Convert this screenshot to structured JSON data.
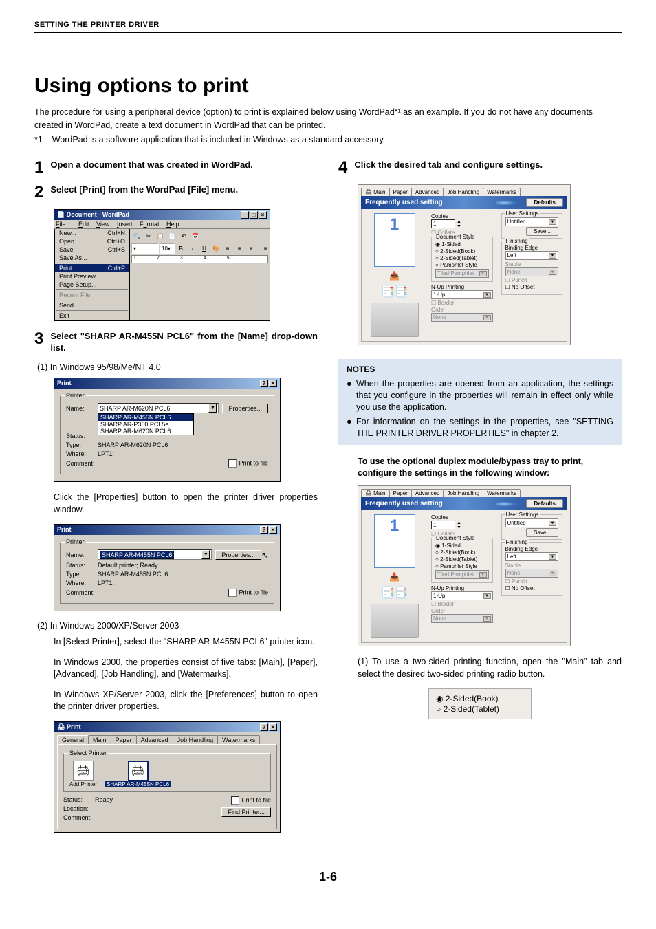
{
  "header": "SETTING THE PRINTER DRIVER",
  "title": "Using options to print",
  "intro": "The procedure for using a peripheral device (option) to print is explained below using WordPad*¹ as an example. If you do not have any documents created in WordPad, create a text document in WordPad that can be printed.",
  "footnote_label": "*1",
  "footnote_text": "WordPad is a software application that is included in Windows as a standard accessory.",
  "step1": {
    "num": "1",
    "text": "Open a document that was created in WordPad."
  },
  "step2": {
    "num": "2",
    "text": "Select [Print] from the WordPad [File] menu."
  },
  "step3": {
    "num": "3",
    "text": "Select \"SHARP AR-M455N PCL6\" from the [Name] drop-down list."
  },
  "step3_sub1": "(1)  In Windows 95/98/Me/NT 4.0",
  "step3_body1": "Click the [Properties] button to open the printer driver properties window.",
  "step3_sub2": "(2)  In Windows 2000/XP/Server 2003",
  "step3_body2a": "In [Select Printer], select the \"SHARP AR-M455N PCL6\" printer icon.",
  "step3_body2b": "In Windows 2000, the properties consist of five tabs: [Main], [Paper], [Advanced], [Job Handling], and [Watermarks].",
  "step3_body2c": "In Windows XP/Server 2003, click the [Preferences] button to open the printer driver properties.",
  "step4": {
    "num": "4",
    "text": "Click the desired tab and configure settings."
  },
  "notes_title": "NOTES",
  "notes": [
    "When the properties are opened from an application, the settings that you configure in the properties will remain in effect only while you use the application.",
    "For information on the settings in the properties, see \"SETTING THE PRINTER DRIVER PROPERTIES\" in chapter 2."
  ],
  "bold_para": "To use the optional duplex module/bypass tray to print, configure the settings in the following window:",
  "duplex_text": "(1) To use a two-sided printing function, open the \"Main\" tab and select the desired two-sided printing radio button.",
  "radio_opts": {
    "book": "2-Sided(Book)",
    "tablet": "2-Sided(Tablet)"
  },
  "page_num": "1-6",
  "wordpad": {
    "title": "Document - WordPad",
    "menus": {
      "file": "File",
      "edit": "Edit",
      "view": "View",
      "insert": "Insert",
      "format": "Format",
      "help": "Help"
    },
    "items": {
      "new": "New...",
      "new_sc": "Ctrl+N",
      "open": "Open...",
      "open_sc": "Ctrl+O",
      "save": "Save",
      "save_sc": "Ctrl+S",
      "saveas": "Save As...",
      "print": "Print...",
      "print_sc": "Ctrl+P",
      "preview": "Print Preview",
      "pagesetup": "Page Setup...",
      "recent": "Recent File",
      "send": "Send...",
      "exit": "Exit"
    },
    "fontsize": "10",
    "ruler": [
      "1",
      "2",
      "3",
      "4",
      "5"
    ]
  },
  "print95": {
    "title": "Print",
    "legend": "Printer",
    "name_lbl": "Name:",
    "name_val": "SHARP AR-M620N PCL6",
    "props_btn": "Properties...",
    "status_lbl": "Status:",
    "type_lbl": "Type:",
    "type_val": "SHARP AR-M620N PCL6",
    "where_lbl": "Where:",
    "where_val": "LPT1:",
    "comment_lbl": "Comment:",
    "printfile": "Print to file",
    "opts": {
      "a": "SHARP AR-M455N PCL6",
      "b": "SHARP AR-P350  PCL5e",
      "c": "SHARP AR-M620N PCL6"
    }
  },
  "print2k": {
    "title": "Print",
    "legend": "Printer",
    "name_lbl": "Name:",
    "name_val": "SHARP AR-M455N PCL6",
    "props_btn": "Properties...",
    "status_lbl": "Status:",
    "status_val": "Default printer; Ready",
    "type_lbl": "Type:",
    "type_val": "SHARP AR-M455N PCL6",
    "where_lbl": "Where:",
    "where_val": "LPT1:",
    "comment_lbl": "Comment:",
    "printfile": "Print to file"
  },
  "printxp": {
    "title": "Print",
    "tabs": [
      "General",
      "Main",
      "Paper",
      "Advanced",
      "Job Handling",
      "Watermarks"
    ],
    "select_printer": "Select Printer",
    "add_printer": "Add Printer",
    "sel_printer": "SHARP AR-M455N PCL6",
    "status_lbl": "Status:",
    "status_val": "Ready",
    "location_lbl": "Location:",
    "comment_lbl": "Comment:",
    "printfile": "Print to file",
    "find_btn": "Find Printer..."
  },
  "props": {
    "tabs": [
      "Main",
      "Paper",
      "Advanced",
      "Job Handling",
      "Watermarks"
    ],
    "freqbar": "Frequently used setting",
    "defaults": "Defaults",
    "copies_lbl": "Copies",
    "copies_val": "1",
    "collate": "Collate",
    "docstyle": "Document Style",
    "ds_1sided": "1-Sided",
    "ds_book": "2-Sided(Book)",
    "ds_tablet": "2-Sided(Tablet)",
    "ds_pamphlet": "Pamphlet Style",
    "tiled": "Tiled Pamphlet",
    "nup_lbl": "N-Up Printing",
    "nup_val": "1-Up",
    "border": "Border",
    "order_lbl": "Order",
    "order_val": "None",
    "user_lbl": "User Settings",
    "user_val": "Untitled",
    "save_btn": "Save...",
    "finishing_lbl": "Finishing",
    "binding_lbl": "Binding Edge",
    "binding_val": "Left",
    "staple_lbl": "Staple",
    "staple_val": "None",
    "punch": "Punch",
    "nooffset": "No Offset"
  }
}
